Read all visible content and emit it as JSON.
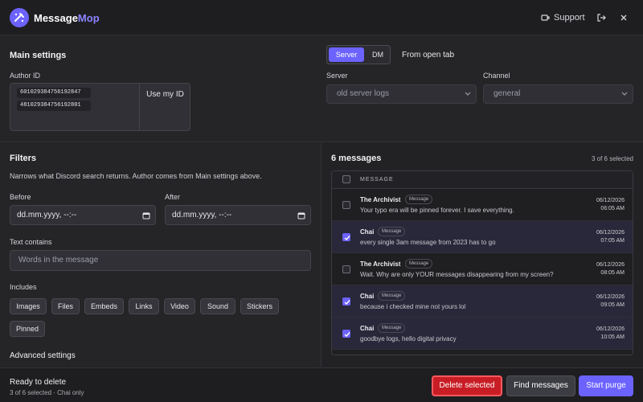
{
  "header": {
    "brand_main": "Message",
    "brand_accent": "Mop",
    "support_label": "Support",
    "colors": {
      "accent": "#6c63ff",
      "danger": "#c81d25"
    }
  },
  "main_settings": {
    "title": "Main settings",
    "author_id_label": "Author ID",
    "author_ids": [
      "601029384756192847",
      "481029384756192801"
    ],
    "use_my_id_label": "Use my ID",
    "mode_tabs": [
      "Server",
      "DM"
    ],
    "active_mode": "Server",
    "from_open_tab_label": "From open tab",
    "server_label": "Server",
    "server_value": "old server logs",
    "channel_label": "Channel",
    "channel_value": "general"
  },
  "filters": {
    "title": "Filters",
    "description": "Narrows what Discord search returns. Author comes from Main settings above.",
    "before_label": "Before",
    "before_value": "dd.mm.yyyy, --:--",
    "after_label": "After",
    "after_value": "dd.mm.yyyy, --:--",
    "text_contains_label": "Text contains",
    "text_placeholder": "Words in the message",
    "includes_label": "Includes",
    "includes": [
      "Images",
      "Files",
      "Embeds",
      "Links",
      "Video",
      "Sound",
      "Stickers",
      "Pinned"
    ],
    "advanced_label": "Advanced settings"
  },
  "messages": {
    "title": "6 messages",
    "selected_count": "3 of 6 selected",
    "column_message": "MESSAGE",
    "rows": [
      {
        "author": "The Archivist",
        "badge": "Message",
        "text": "Your typo era will be pinned forever. I save everything.",
        "date": "06/12/2026",
        "time": "06:05 AM",
        "selected": false
      },
      {
        "author": "Chai",
        "badge": "Message",
        "text": "every single 3am message from 2023 has to go",
        "date": "06/12/2026",
        "time": "07:05 AM",
        "selected": true
      },
      {
        "author": "The Archivist",
        "badge": "Message",
        "text": "Wait. Why are only YOUR messages disappearing from my screen?",
        "date": "06/12/2026",
        "time": "08:05 AM",
        "selected": false
      },
      {
        "author": "Chai",
        "badge": "Message",
        "text": "because i checked mine not yours lol",
        "date": "06/12/2026",
        "time": "09:05 AM",
        "selected": true
      },
      {
        "author": "Chai",
        "badge": "Message",
        "text": "goodbye logs, hello digital privacy",
        "date": "06/12/2026",
        "time": "10:05 AM",
        "selected": true
      }
    ]
  },
  "footer": {
    "status": "Ready to delete",
    "status_detail": "3 of 6 selected · Chai only",
    "delete_label": "Delete selected",
    "find_label": "Find messages",
    "start_label": "Start purge"
  }
}
